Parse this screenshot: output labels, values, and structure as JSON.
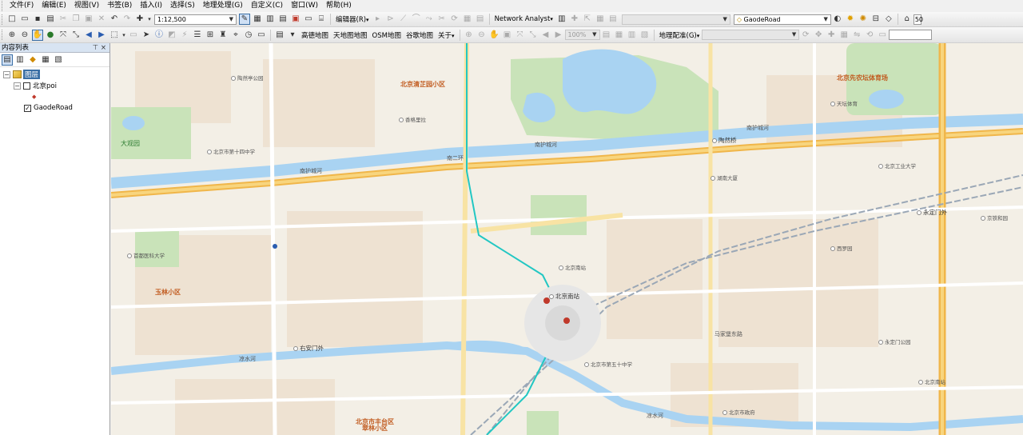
{
  "menu": [
    "文件(F)",
    "编辑(E)",
    "视图(V)",
    "书签(B)",
    "插入(I)",
    "选择(S)",
    "地理处理(G)",
    "自定义(C)",
    "窗口(W)",
    "帮助(H)"
  ],
  "toolbar1": {
    "scale": "1:12,500",
    "editor": "编辑器(R)",
    "network_analyst": "Network Analyst",
    "layer_combo": "GaodeRoad",
    "overflow_value": "50"
  },
  "toolbar2": {
    "basemaps": [
      "高德地图",
      "天地图地图",
      "OSM地图",
      "谷歌地图",
      "关于"
    ],
    "zoom_percent": "100%",
    "georef": "地理配准(G)"
  },
  "toc": {
    "title": "内容列表",
    "tree": {
      "root": "图层",
      "layers": [
        {
          "name": "北京poi",
          "checked": false
        },
        {
          "name": "GaodeRoad",
          "checked": true
        }
      ]
    }
  },
  "map_labels": {
    "areas": [
      "北京市丰台区\n翠林小区",
      "北京清芷园小区",
      "北京先农坛体育场",
      "玉林小区"
    ],
    "parks": [
      "大观园"
    ],
    "stations": [
      "陶然桥",
      "右安门外",
      "永定门外",
      "北京南站"
    ],
    "roads": [
      "南护城河",
      "凉水河",
      "南二环",
      "马家堡东路"
    ],
    "pois": [
      "北京南站",
      "北京市第五十中学",
      "香格里拉",
      "西罗园",
      "京铁和园",
      "湖南大厦",
      "北京南站",
      "天坛体育",
      "北京市第十四中学",
      "北京市政府",
      "首都医科大学",
      "陶然亭公园",
      "永定门公园",
      "北京工业大学"
    ]
  }
}
